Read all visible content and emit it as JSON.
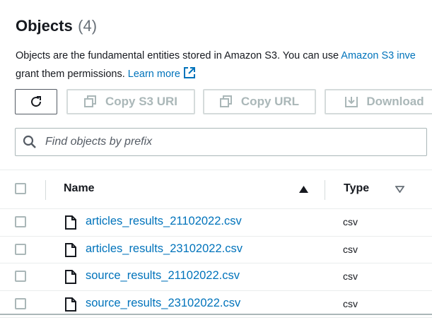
{
  "header": {
    "title": "Objects",
    "count": "(4)",
    "description_line1": "Objects are the fundamental entities stored in Amazon S3. You can use ",
    "description_link": "Amazon S3 inve",
    "description_line2": "grant them permissions. ",
    "learn_more": "Learn more"
  },
  "toolbar": {
    "copy_s3_uri": "Copy S3 URI",
    "copy_url": "Copy URL",
    "download": "Download"
  },
  "search": {
    "placeholder": "Find objects by prefix",
    "value": ""
  },
  "table": {
    "columns": [
      "Name",
      "Type"
    ],
    "rows": [
      {
        "name": "articles_results_21102022.csv",
        "type": "csv"
      },
      {
        "name": "articles_results_23102022.csv",
        "type": "csv"
      },
      {
        "name": "source_results_21102022.csv",
        "type": "csv"
      },
      {
        "name": "source_results_23102022.csv",
        "type": "csv"
      }
    ]
  },
  "colors": {
    "link": "#0073bb",
    "text": "#16191f",
    "disabled": "#aab7b8"
  }
}
